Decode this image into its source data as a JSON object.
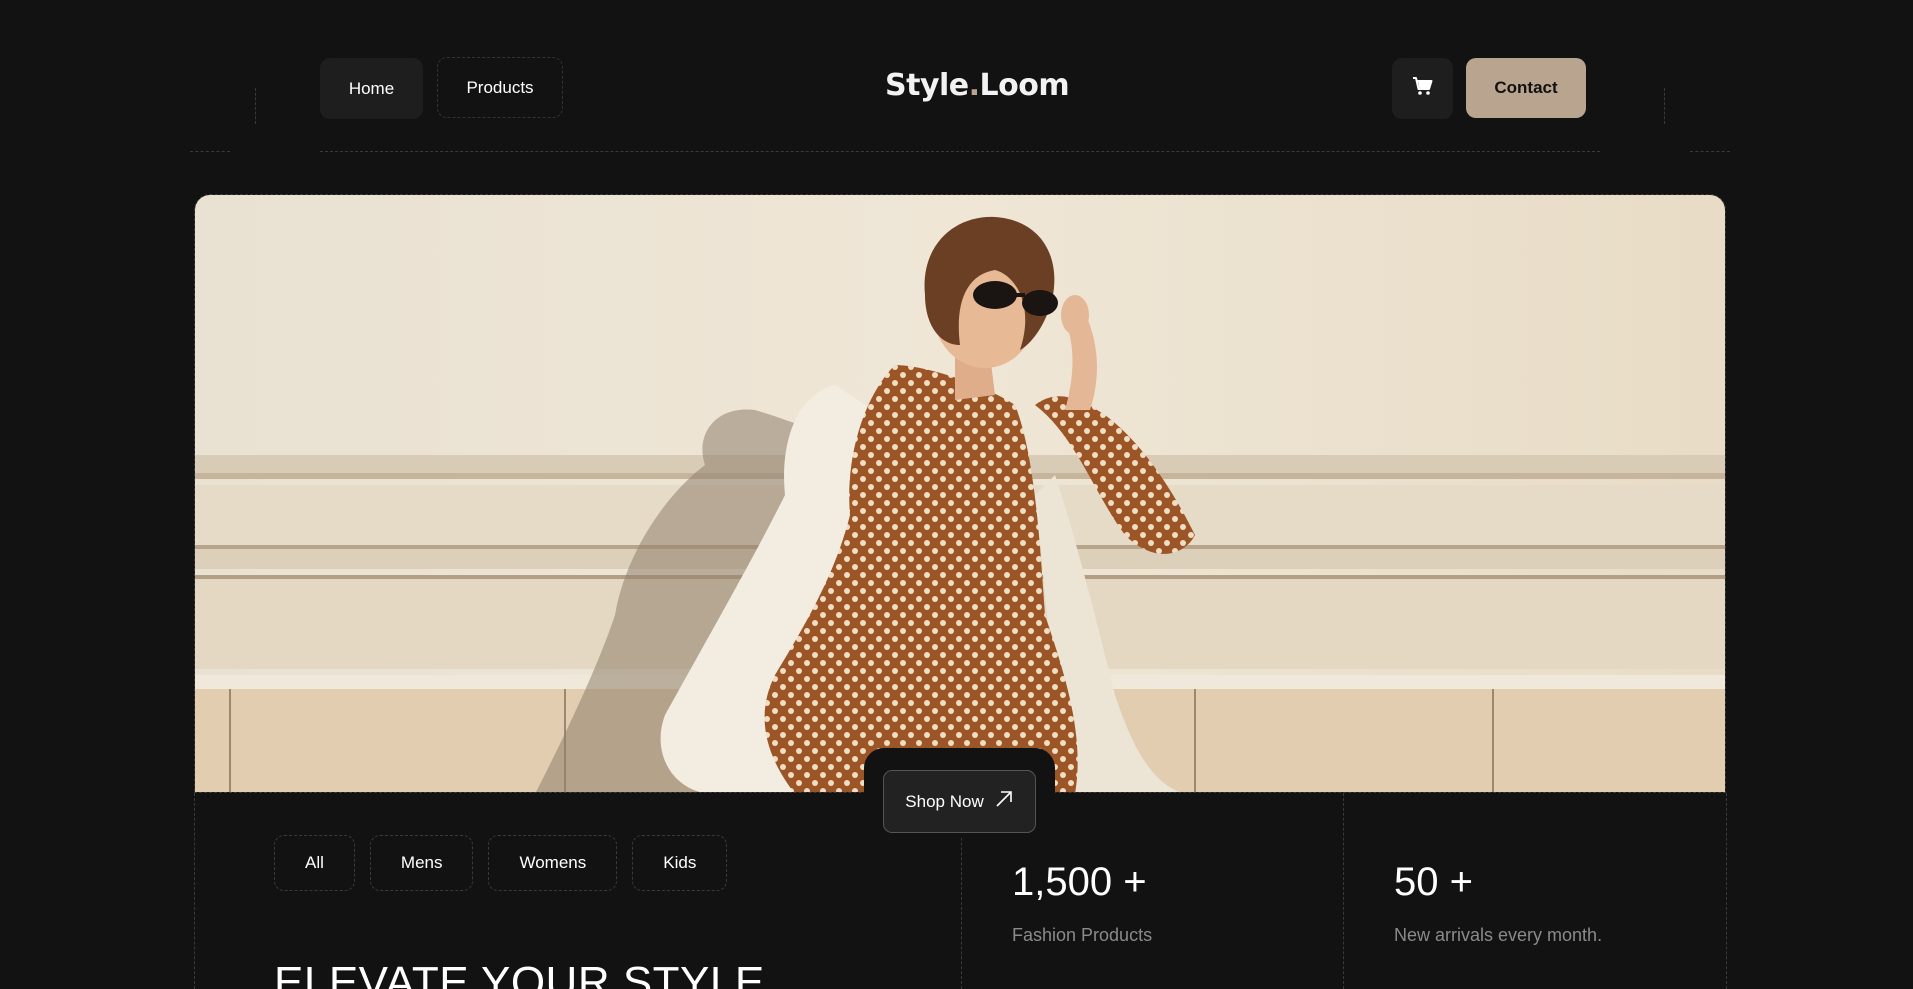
{
  "nav": {
    "home_label": "Home",
    "products_label": "Products",
    "logo_part1": "Style",
    "logo_dot": ".",
    "logo_part2": "Loom",
    "contact_label": "Contact",
    "cart_icon": "cart-icon"
  },
  "hero": {
    "shop_now_label": "Shop Now",
    "arrow_icon": "arrow-up-right-icon"
  },
  "filters": [
    "All",
    "Mens",
    "Womens",
    "Kids"
  ],
  "headline": "ELEVATE YOUR STYLE",
  "stats": [
    {
      "value": "1,500 +",
      "label": "Fashion Products"
    },
    {
      "value": "50 +",
      "label": "New arrivals every month."
    }
  ],
  "colors": {
    "background": "#121212",
    "accent": "#b9a58f",
    "button_dark": "#1e1e1e",
    "muted_text": "#8a8a8a"
  }
}
